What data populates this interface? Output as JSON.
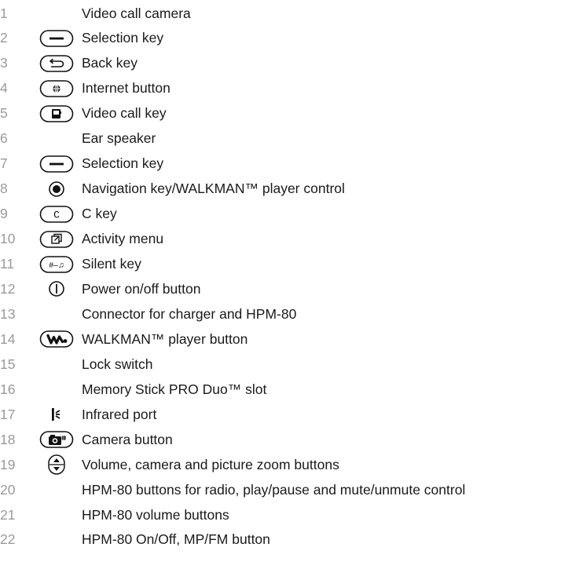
{
  "items": [
    {
      "num": "1",
      "icon": "",
      "label": "Video call camera"
    },
    {
      "num": "2",
      "icon": "selection-key-icon",
      "label": "Selection key"
    },
    {
      "num": "3",
      "icon": "back-key-icon",
      "label": "Back key"
    },
    {
      "num": "4",
      "icon": "internet-key-icon",
      "label": "Internet button"
    },
    {
      "num": "5",
      "icon": "video-call-key-icon",
      "label": "Video call key"
    },
    {
      "num": "6",
      "icon": "",
      "label": "Ear speaker"
    },
    {
      "num": "7",
      "icon": "selection-key-icon",
      "label": "Selection key"
    },
    {
      "num": "8",
      "icon": "navigation-key-icon",
      "label": "Navigation key/WALKMAN™ player control"
    },
    {
      "num": "9",
      "icon": "c-key-icon",
      "label": "C key"
    },
    {
      "num": "10",
      "icon": "activity-menu-key-icon",
      "label": "Activity menu"
    },
    {
      "num": "11",
      "icon": "silent-key-icon",
      "label": "Silent key"
    },
    {
      "num": "12",
      "icon": "power-icon",
      "label": "Power on/off button"
    },
    {
      "num": "13",
      "icon": "",
      "label": "Connector for charger and HPM-80"
    },
    {
      "num": "14",
      "icon": "walkman-key-icon",
      "label": "WALKMAN™ player button"
    },
    {
      "num": "15",
      "icon": "",
      "label": "Lock switch"
    },
    {
      "num": "16",
      "icon": "",
      "label": "Memory Stick PRO Duo™ slot"
    },
    {
      "num": "17",
      "icon": "infrared-icon",
      "label": "Infrared port"
    },
    {
      "num": "18",
      "icon": "camera-key-icon",
      "label": "Camera button"
    },
    {
      "num": "19",
      "icon": "volume-zoom-key-icon",
      "label": "Volume, camera and picture zoom buttons"
    },
    {
      "num": "20",
      "icon": "",
      "label": "HPM-80 buttons for radio, play/pause and mute/unmute control"
    },
    {
      "num": "21",
      "icon": "",
      "label": "HPM-80 volume buttons"
    },
    {
      "num": "22",
      "icon": "",
      "label": "HPM-80 On/Off, MP/FM button"
    }
  ],
  "icon_keys": {
    "c_key": "C",
    "silent_key": "#–♫"
  }
}
